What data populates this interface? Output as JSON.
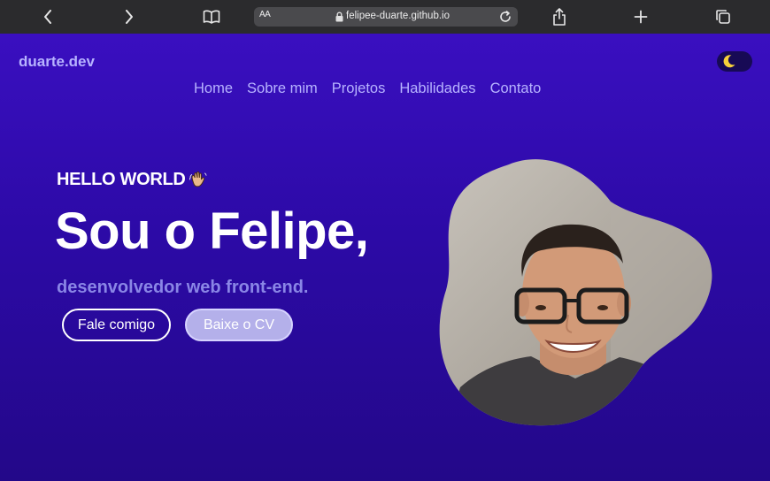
{
  "browser": {
    "url": "felipee-duarte.github.io",
    "text_size_label": "AA",
    "icons": {
      "back": "chevron-left-icon",
      "forward": "chevron-right-icon",
      "reader": "book-icon",
      "lock": "lock-icon",
      "reload": "reload-icon",
      "share": "share-icon",
      "new_tab": "plus-icon",
      "tabs": "tabs-icon"
    }
  },
  "site": {
    "logo": "duarte.dev",
    "theme_toggle_icon": "moon-icon",
    "nav": [
      {
        "label": "Home"
      },
      {
        "label": "Sobre mim"
      },
      {
        "label": "Projetos"
      },
      {
        "label": "Habilidades"
      },
      {
        "label": "Contato"
      }
    ]
  },
  "hero": {
    "greeting": "HELLO WORLD",
    "greeting_icon": "waving-hand-icon",
    "headline": "Sou o Felipe,",
    "subtitle": "desenvolvedor web front-end.",
    "contact_button": "Fale comigo",
    "cv_button": "Baixe o CV",
    "photo_icon": "profile-photo"
  },
  "colors": {
    "background": "#2c0aa6",
    "accent": "#b7b3ff",
    "subtitle": "#8a86e6",
    "toolbar": "#2b2b2d"
  }
}
